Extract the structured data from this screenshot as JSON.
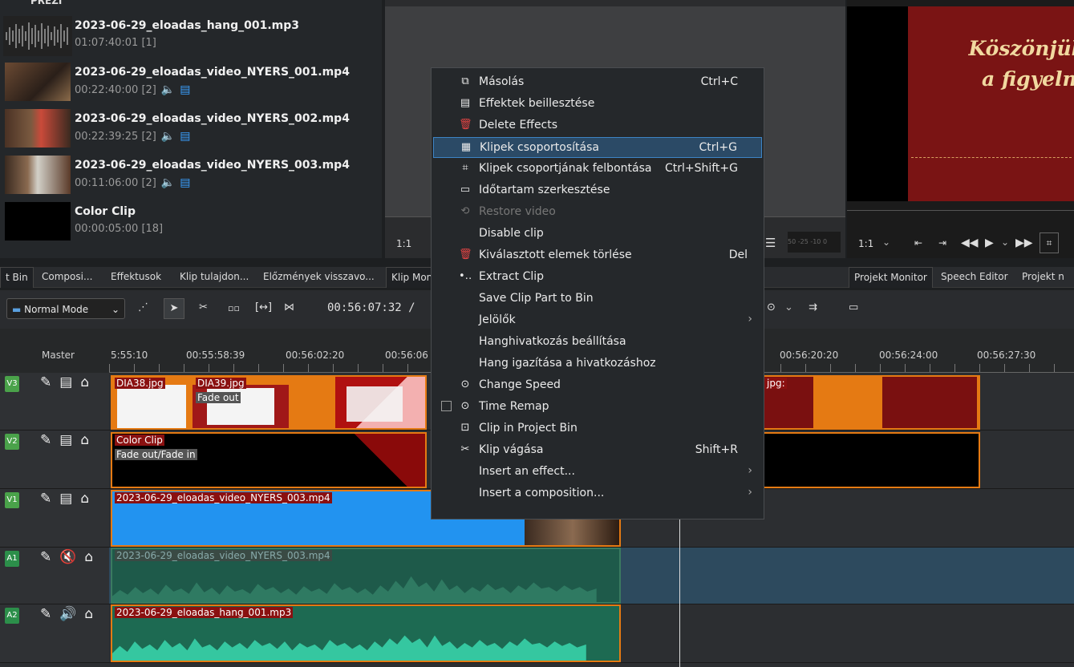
{
  "bin": {
    "top_fragment": "PREZI",
    "items": [
      {
        "name": "2023-06-29_eloadas_hang_001.mp3",
        "meta": "01:07:40:01 [1]",
        "audio_icon": "",
        "video_icon": ""
      },
      {
        "name": "2023-06-29_eloadas_video_NYERS_001.mp4",
        "meta": "00:22:40:00 [2]",
        "audio_icon": "speaker-icon",
        "video_icon": "film-icon"
      },
      {
        "name": "2023-06-29_eloadas_video_NYERS_002.mp4",
        "meta": "00:22:39:25 [2]",
        "audio_icon": "speaker-icon",
        "video_icon": "film-icon"
      },
      {
        "name": "2023-06-29_eloadas_video_NYERS_003.mp4",
        "meta": "00:11:06:00 [2]",
        "audio_icon": "speaker-icon",
        "video_icon": "film-icon"
      },
      {
        "name": "Color Clip",
        "meta": "00:00:05:00 [18]",
        "audio_icon": "",
        "video_icon": ""
      }
    ]
  },
  "clip_monitor": {
    "zoom": "1:1",
    "audio_meter": "50 -25 -10 0"
  },
  "project_monitor": {
    "zoom": "1:1",
    "slide_line1": "Köszönjük",
    "slide_line2": "a figyelm"
  },
  "tabs": {
    "left": [
      "t Bin",
      "Composi...",
      "Effektusok",
      "Klip tulajdon...",
      "Előzmények visszavo..."
    ],
    "middle": "Klip Mon",
    "right": [
      "Projekt Monitor",
      "Speech Editor",
      "Projekt n"
    ]
  },
  "toolbar": {
    "mode": "Normal Mode",
    "timecode": "00:56:07:32 /"
  },
  "timeline": {
    "master_label": "Master",
    "ticks": [
      "5:55:10",
      "00:55:58:39",
      "00:56:02:20",
      "00:56:06",
      "00:56:20:20",
      "00:56:24:00",
      "00:56:27:30"
    ],
    "tracks": [
      {
        "tag": "V3",
        "type": "video"
      },
      {
        "tag": "V2",
        "type": "video"
      },
      {
        "tag": "V1",
        "type": "video"
      },
      {
        "tag": "A1",
        "type": "audio"
      },
      {
        "tag": "A2",
        "type": "audio"
      }
    ],
    "clips": {
      "v3_a": "DIA38.jpg",
      "v3_b": "DIA39.jpg",
      "v3_b_sub": "Fade out",
      "v3_c": "jpg:",
      "v2": "Color Clip",
      "v2_sub": "Fade out/Fade in",
      "v1": "2023-06-29_eloadas_video_NYERS_003.mp4",
      "a1": "2023-06-29_eloadas_video_NYERS_003.mp4",
      "a2": "2023-06-29_eloadas_hang_001.mp3"
    }
  },
  "context_menu": {
    "items": [
      {
        "icon": "copy-icon",
        "glyph": "⧉",
        "label": "Másolás",
        "shortcut": "Ctrl+C"
      },
      {
        "icon": "paste-effects-icon",
        "glyph": "▤",
        "label": "Effektek beillesztése",
        "shortcut": ""
      },
      {
        "icon": "trash-icon",
        "glyph": "🗑",
        "label": "Delete Effects",
        "shortcut": ""
      },
      {
        "icon": "group-icon",
        "glyph": "▦",
        "label": "Klipek csoportosítása",
        "shortcut": "Ctrl+G"
      },
      {
        "icon": "ungroup-icon",
        "glyph": "⌗",
        "label": "Klipek csoportjának felbontása",
        "shortcut": "Ctrl+Shift+G"
      },
      {
        "icon": "duration-icon",
        "glyph": "▭",
        "label": "Időtartam szerkesztése",
        "shortcut": ""
      },
      {
        "icon": "restore-icon",
        "glyph": "⟲",
        "label": "Restore video",
        "shortcut": ""
      },
      {
        "icon": "",
        "glyph": "",
        "label": "Disable clip",
        "shortcut": ""
      },
      {
        "icon": "trash-icon",
        "glyph": "🗑",
        "label": "Kiválasztott elemek törlése",
        "shortcut": "Del"
      },
      {
        "icon": "extract-icon",
        "glyph": "•‥",
        "label": "Extract Clip",
        "shortcut": ""
      },
      {
        "icon": "",
        "glyph": "",
        "label": "Save Clip Part to Bin",
        "shortcut": ""
      },
      {
        "icon": "",
        "glyph": "",
        "label": "Jelölők",
        "shortcut": ""
      },
      {
        "icon": "",
        "glyph": "",
        "label": "Hanghivatkozás beállítása",
        "shortcut": ""
      },
      {
        "icon": "",
        "glyph": "",
        "label": "Hang igazítása a hivatkozáshoz",
        "shortcut": ""
      },
      {
        "icon": "speed-icon",
        "glyph": "⊙",
        "label": "Change Speed",
        "shortcut": ""
      },
      {
        "icon": "speed-icon",
        "glyph": "⊙",
        "label": "Time Remap",
        "shortcut": ""
      },
      {
        "icon": "bin-clip-icon",
        "glyph": "⊡",
        "label": "Clip in Project Bin",
        "shortcut": ""
      },
      {
        "icon": "scissors-icon",
        "glyph": "✂",
        "label": "Klip vágása",
        "shortcut": "Shift+R"
      },
      {
        "icon": "",
        "glyph": "",
        "label": "Insert an effect...",
        "shortcut": ""
      },
      {
        "icon": "",
        "glyph": "",
        "label": "Insert a composition...",
        "shortcut": ""
      }
    ]
  }
}
